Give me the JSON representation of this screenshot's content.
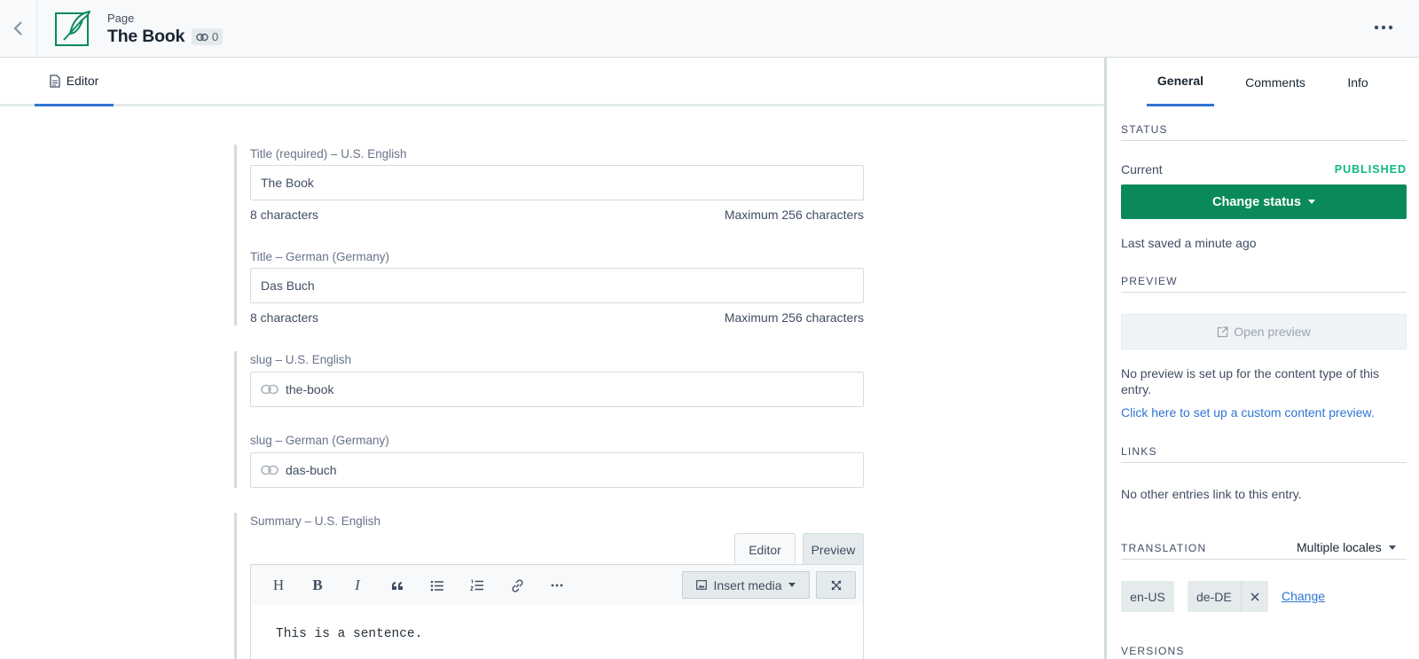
{
  "header": {
    "entry_type": "Page",
    "title": "The Book",
    "link_count": "0"
  },
  "editor_tab": {
    "label": "Editor"
  },
  "fields": {
    "title_en": {
      "label": "Title (required) – U.S. English",
      "value": "The Book",
      "count": "8 characters",
      "max": "Maximum 256 characters"
    },
    "title_de": {
      "label": "Title – German (Germany)",
      "value": "Das Buch",
      "count": "8 characters",
      "max": "Maximum 256 characters"
    },
    "slug_en": {
      "label": "slug – U.S. English",
      "value": "the-book"
    },
    "slug_de": {
      "label": "slug – German (Germany)",
      "value": "das-buch"
    },
    "summary_en": {
      "label": "Summary – U.S. English",
      "mode_editor": "Editor",
      "mode_preview": "Preview",
      "insert_media": "Insert media",
      "content": "This is a sentence.",
      "toolbar": [
        "heading-icon",
        "bold-icon",
        "italic-icon",
        "quote-icon",
        "bullet-list-icon",
        "numbered-list-icon",
        "link-icon",
        "more-icon"
      ]
    }
  },
  "sidebar": {
    "tabs": [
      "General",
      "Comments",
      "Info"
    ],
    "status": {
      "heading": "STATUS",
      "current_label": "Current",
      "current_value": "PUBLISHED",
      "button": "Change status",
      "last_saved": "Last saved a minute ago"
    },
    "preview": {
      "heading": "PREVIEW",
      "button": "Open preview",
      "note": "No preview is set up for the content type of this entry.",
      "link": "Click here to set up a custom content preview."
    },
    "links": {
      "heading": "LINKS",
      "note": "No other entries link to this entry."
    },
    "translation": {
      "heading": "TRANSLATION",
      "mode": "Multiple locales",
      "locales": [
        "en-US",
        "de-DE"
      ],
      "change": "Change"
    },
    "versions": {
      "heading": "VERSIONS"
    }
  },
  "colors": {
    "accent": "#2e75d4",
    "published": "#0eb87f",
    "primary_button": "#0a8a5a",
    "icon_green": "#0a8a5a"
  }
}
